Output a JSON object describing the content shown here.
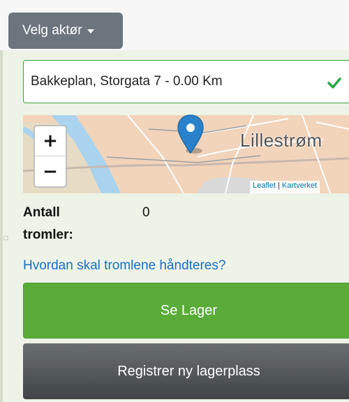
{
  "header": {
    "actor_button_label": "Velg aktør"
  },
  "location_select": {
    "selected_value": "Bakkeplan, Storgata 7 - 0.00 Km"
  },
  "map": {
    "city_label": "Lillestrøm",
    "zoom_in_label": "+",
    "zoom_out_label": "−",
    "attribution_leaflet": "Leaflet",
    "attribution_separator": "|",
    "attribution_kartverket": "Kartverket",
    "marker_color": "#2a81cb"
  },
  "info": {
    "drum_count_label": "Antall tromler:",
    "drum_count_value": "0"
  },
  "help": {
    "link_text": "Hvordan skal tromlene håndteres?"
  },
  "actions": {
    "primary_label": "Se Lager",
    "primary_color": "#5aac39",
    "secondary_label": "Registrer ny lagerplass",
    "secondary_color": "#4b5054"
  }
}
